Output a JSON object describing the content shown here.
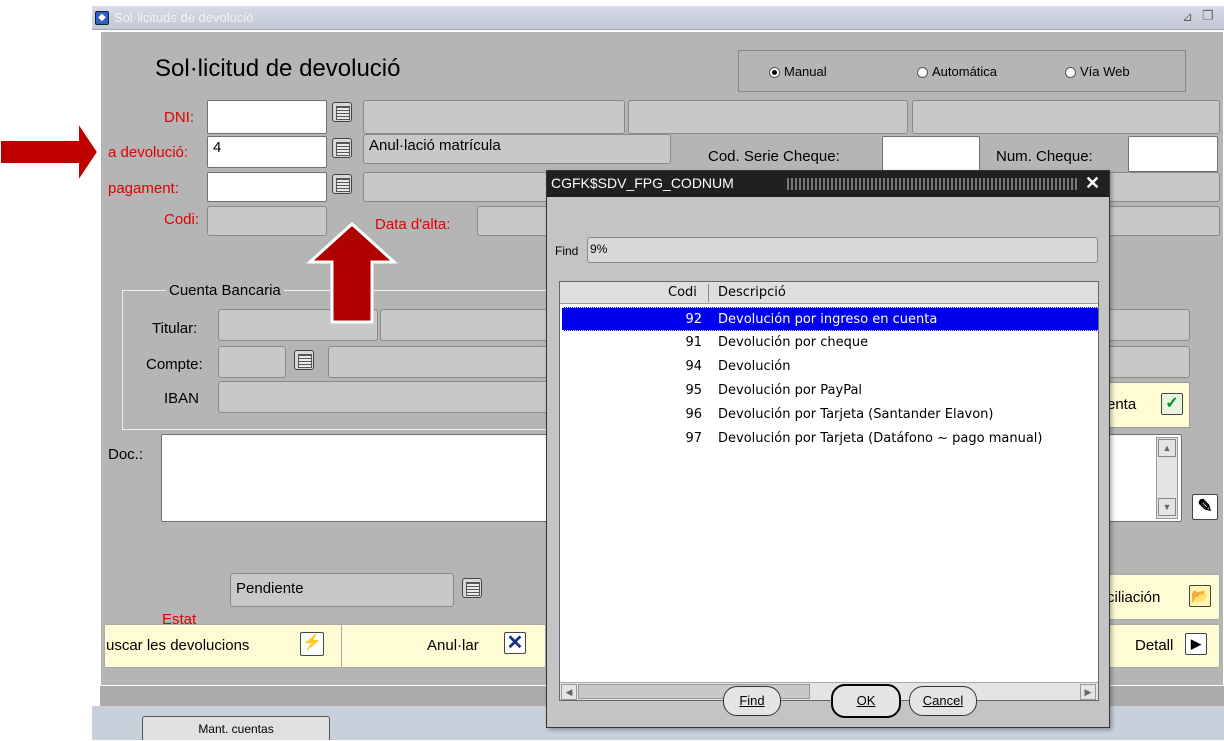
{
  "window": {
    "title": "Sol·licituds de devolució",
    "app_icon": "oracle-forms-icon",
    "controls": [
      "resize-icon",
      "restore-icon"
    ]
  },
  "form": {
    "heading": "Sol·licitud de devolució",
    "mode": {
      "options": [
        "Manual",
        "Automática",
        "Vía Web"
      ],
      "selected": "Manual"
    },
    "labels": {
      "dni": "DNI:",
      "tipus": "a devolució:",
      "forma": "pagament:",
      "codi": "Codi:",
      "data_alta": "Data d'alta:",
      "cod_serie": "Cod. Serie Cheque:",
      "num_cheque": "Num. Cheque:"
    },
    "values": {
      "dni": "",
      "tipus_code": "4",
      "tipus_desc": "Anul·lació matrícula",
      "forma_code": "",
      "codi": ""
    },
    "bank": {
      "section_title": "Cuenta Bancaria",
      "titular_label": "Titular:",
      "compte_label": "Compte:",
      "iban_label": "IBAN",
      "cuenta_button": "enta"
    },
    "doc_label": "Doc.:",
    "estat_label": "Estat",
    "estat_value": "Pendiente",
    "conciliacion_button": "ciliación",
    "actions": {
      "buscar": "uscar les devolucions",
      "anular": "Anul·lar",
      "detall": "Detall"
    },
    "tab_button": "Mant. cuentas"
  },
  "lov_dialog": {
    "title": "CGFK$SDV_FPG_CODNUM",
    "find_label": "Find",
    "find_value": "9%",
    "columns": [
      "Codi",
      "Descripció"
    ],
    "rows": [
      {
        "codi": "92",
        "desc": "Devolución por ingreso en cuenta"
      },
      {
        "codi": "91",
        "desc": "Devolución por cheque"
      },
      {
        "codi": "94",
        "desc": "Devolución"
      },
      {
        "codi": "95",
        "desc": "Devolución por PayPal"
      },
      {
        "codi": "96",
        "desc": "Devolución por Tarjeta (Santander Elavon)"
      },
      {
        "codi": "97",
        "desc": "Devolución por Tarjeta (Datáfono ~ pago manual)"
      }
    ],
    "selected_row": 0,
    "buttons": {
      "find": "Find",
      "ok": "OK",
      "cancel": "Cancel"
    }
  },
  "annotations": {
    "arrow_color": "#c00000"
  }
}
